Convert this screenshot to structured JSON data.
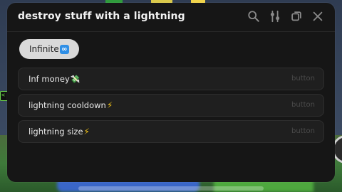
{
  "window": {
    "title": "destroy stuff with a lightning"
  },
  "title_icons": [
    "search-icon",
    "sliders-icon",
    "window-icon",
    "close-icon"
  ],
  "tabs": [
    {
      "label": "Infinite",
      "badge_symbol": "∞",
      "selected": true
    }
  ],
  "buttons": [
    {
      "label": "Inf money",
      "emoji": "💸",
      "type": "button"
    },
    {
      "label": "lightning cooldown",
      "emoji": "⚡",
      "type": "button"
    },
    {
      "label": "lightning size",
      "emoji": "⚡",
      "type": "button"
    }
  ],
  "colors": {
    "panel": "#161616",
    "row": "#1f1f1f",
    "tab_pill": "#d9d9d9",
    "accent_blue": "#2f8fe6",
    "bolt": "#f5c518"
  }
}
